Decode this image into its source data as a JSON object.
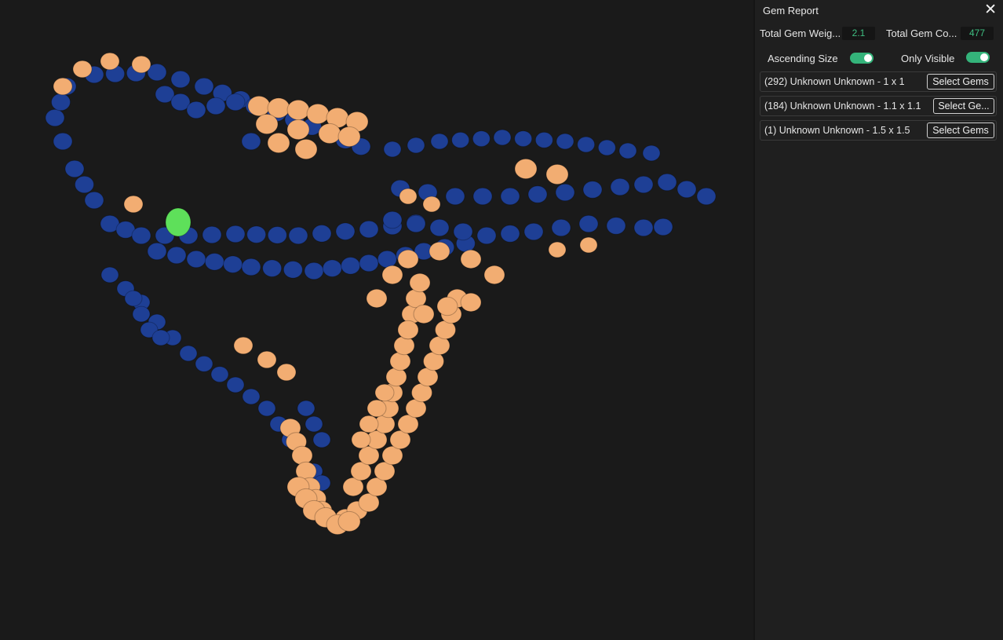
{
  "panel": {
    "title": "Gem Report",
    "close_icon": "close-icon",
    "total_weight_label": "Total Gem Weig...",
    "total_weight_value": "2.1",
    "total_count_label": "Total Gem Co...",
    "total_count_value": "477",
    "ascending_label": "Ascending Size",
    "ascending_on": true,
    "only_visible_label": "Only Visible",
    "only_visible_on": true,
    "groups": [
      {
        "label": "(292) Unknown Unknown - 1 x 1",
        "button": "Select Gems"
      },
      {
        "label": "(184) Unknown Unknown - 1.1 x 1.1",
        "button": "Select Ge..."
      },
      {
        "label": "(1) Unknown Unknown - 1.5 x 1.5",
        "button": "Select Gems"
      }
    ]
  },
  "colors": {
    "background": "#1a1a1a",
    "gem_blue": "#1e3f95",
    "gem_orange": "#f2ad72",
    "gem_green": "#5ee05a",
    "accent": "#34b37a"
  }
}
